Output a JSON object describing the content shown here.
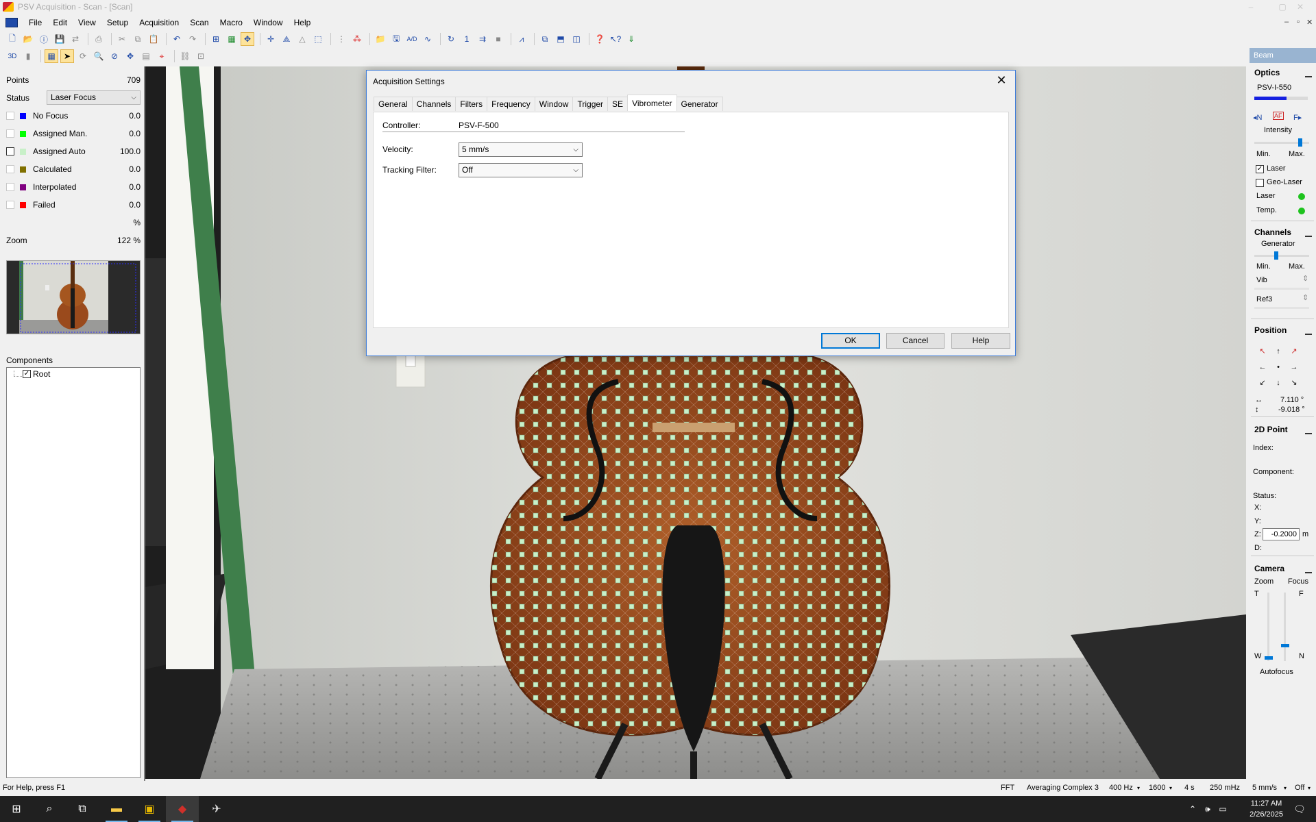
{
  "window": {
    "title": "PSV Acquisition - Scan - [Scan]",
    "controls": [
      "–",
      "▢",
      "✕"
    ]
  },
  "menu": {
    "items": [
      "File",
      "Edit",
      "View",
      "Setup",
      "Acquisition",
      "Scan",
      "Macro",
      "Window",
      "Help"
    ],
    "mdi_controls": [
      "–",
      "▫",
      "✕"
    ]
  },
  "toolbar2": {
    "view3d_label": "3D"
  },
  "left": {
    "points_label": "Points",
    "points_value": "709",
    "status_label": "Status",
    "status_value": "Laser Focus",
    "legend": [
      {
        "label": "No Focus",
        "value": "0.0",
        "color": "#0000ff"
      },
      {
        "label": "Assigned Man.",
        "value": "0.0",
        "color": "#00ff00"
      },
      {
        "label": "Assigned Auto",
        "value": "100.0",
        "color": "#c8f0c8"
      },
      {
        "label": "Calculated",
        "value": "0.0",
        "color": "#807000"
      },
      {
        "label": "Interpolated",
        "value": "0.0",
        "color": "#800080"
      },
      {
        "label": "Failed",
        "value": "0.0",
        "color": "#ff0000"
      }
    ],
    "percent_unit": "%",
    "zoom_label": "Zoom",
    "zoom_value": "122 %",
    "components_label": "Components",
    "tree_root": "Root"
  },
  "dialog": {
    "title": "Acquisition Settings",
    "tabs": [
      "General",
      "Channels",
      "Filters",
      "Frequency",
      "Window",
      "Trigger",
      "SE",
      "Vibrometer",
      "Generator"
    ],
    "active_tab": "Vibrometer",
    "controller_label": "Controller:",
    "controller_value": "PSV-F-500",
    "velocity_label": "Velocity:",
    "velocity_value": "5 mm/s",
    "tracking_label": "Tracking Filter:",
    "tracking_value": "Off",
    "ok_label": "OK",
    "cancel_label": "Cancel",
    "help_label": "Help"
  },
  "right": {
    "header": "Beam",
    "optics": {
      "title": "Optics",
      "device": "PSV-I-550",
      "intensity_label": "Intensity",
      "min_label": "Min.",
      "max_label": "Max.",
      "laser_checkbox": "Laser",
      "geo_checkbox": "Geo-Laser",
      "laser_status": "Laser",
      "temp_status": "Temp.",
      "focus_buttons": [
        "◂N",
        "AF",
        "F▸"
      ]
    },
    "channels": {
      "title": "Channels",
      "generator_label": "Generator",
      "min_label": "Min.",
      "max_label": "Max.",
      "vib_label": "Vib",
      "ref_label": "Ref3"
    },
    "position": {
      "title": "Position",
      "h_value": "7.110 °",
      "v_value": "-9.018 °"
    },
    "point2d": {
      "title": "2D Point",
      "index_label": "Index:",
      "component_label": "Component:",
      "status_label": "Status:",
      "x_label": "X:",
      "y_label": "Y:",
      "z_label": "Z:",
      "z_value": "-0.2000",
      "z_unit": "m",
      "d_label": "D:"
    },
    "camera": {
      "title": "Camera",
      "zoom_label": "Zoom",
      "focus_label": "Focus",
      "t_label": "T",
      "f_label": "F",
      "w_label": "W",
      "n_label": "N",
      "autofocus_label": "Autofocus"
    }
  },
  "statusbar": {
    "help": "For Help, press F1",
    "fft": "FFT",
    "averaging": "Averaging Complex 3",
    "bandwidth": "400 Hz",
    "lines": "1600",
    "time": "4 s",
    "sample": "250 mHz",
    "velocity": "5 mm/s",
    "filter": "Off"
  },
  "taskbar": {
    "time": "11:27 AM",
    "date": "2/26/2025"
  },
  "colors": {
    "scan_point": "#c8f0c8",
    "accent": "#0078d7",
    "dialog_border": "#3c7bd9"
  }
}
